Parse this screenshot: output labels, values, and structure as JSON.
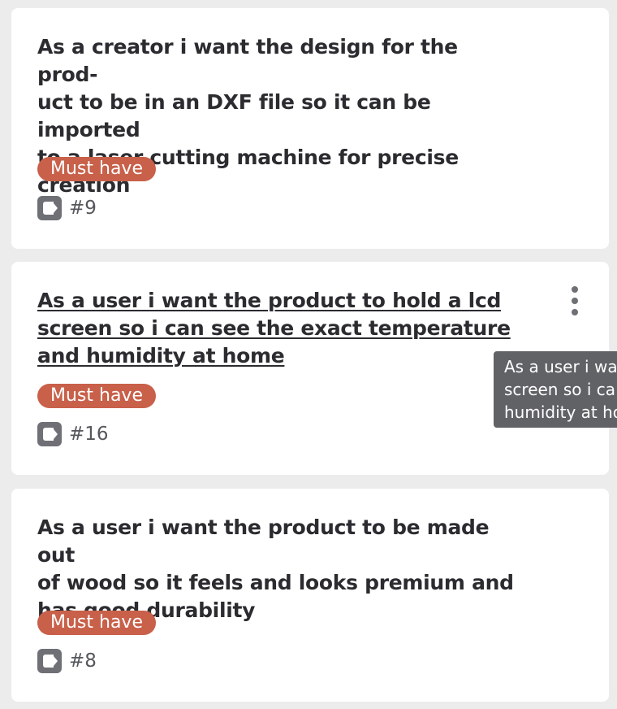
{
  "cards": [
    {
      "title_lines": [
        "As a creator i want the design for the prod-",
        "uct to be in an DXF file so it can be imported",
        "to a laser cutting machine for precise",
        "creation"
      ],
      "label": "Must have",
      "issue_number": "#9",
      "issue_icon": "issue-icon"
    },
    {
      "title_lines": [
        "As a user i want the product to hold a lcd",
        "screen so i can see the exact temperature",
        "and humidity at home"
      ],
      "label": "Must have",
      "issue_number": "#16",
      "issue_icon": "issue-icon",
      "menu_icon": "kebab-menu-icon"
    },
    {
      "title_lines": [
        "As a user i want the product to be made out",
        "of wood so it feels and looks premium and",
        "has good durability"
      ],
      "label": "Must have",
      "issue_number": "#8",
      "issue_icon": "issue-icon"
    }
  ],
  "tooltip": {
    "lines": [
      "As a user i wa",
      "screen so i ca",
      "humidity at ho"
    ]
  },
  "colors": {
    "background": "#ececed",
    "card": "#ffffff",
    "label_bg": "#c8604a",
    "title_text": "#2b2b30",
    "icon_gray": "#6e7076",
    "tooltip_bg": "#606266"
  }
}
